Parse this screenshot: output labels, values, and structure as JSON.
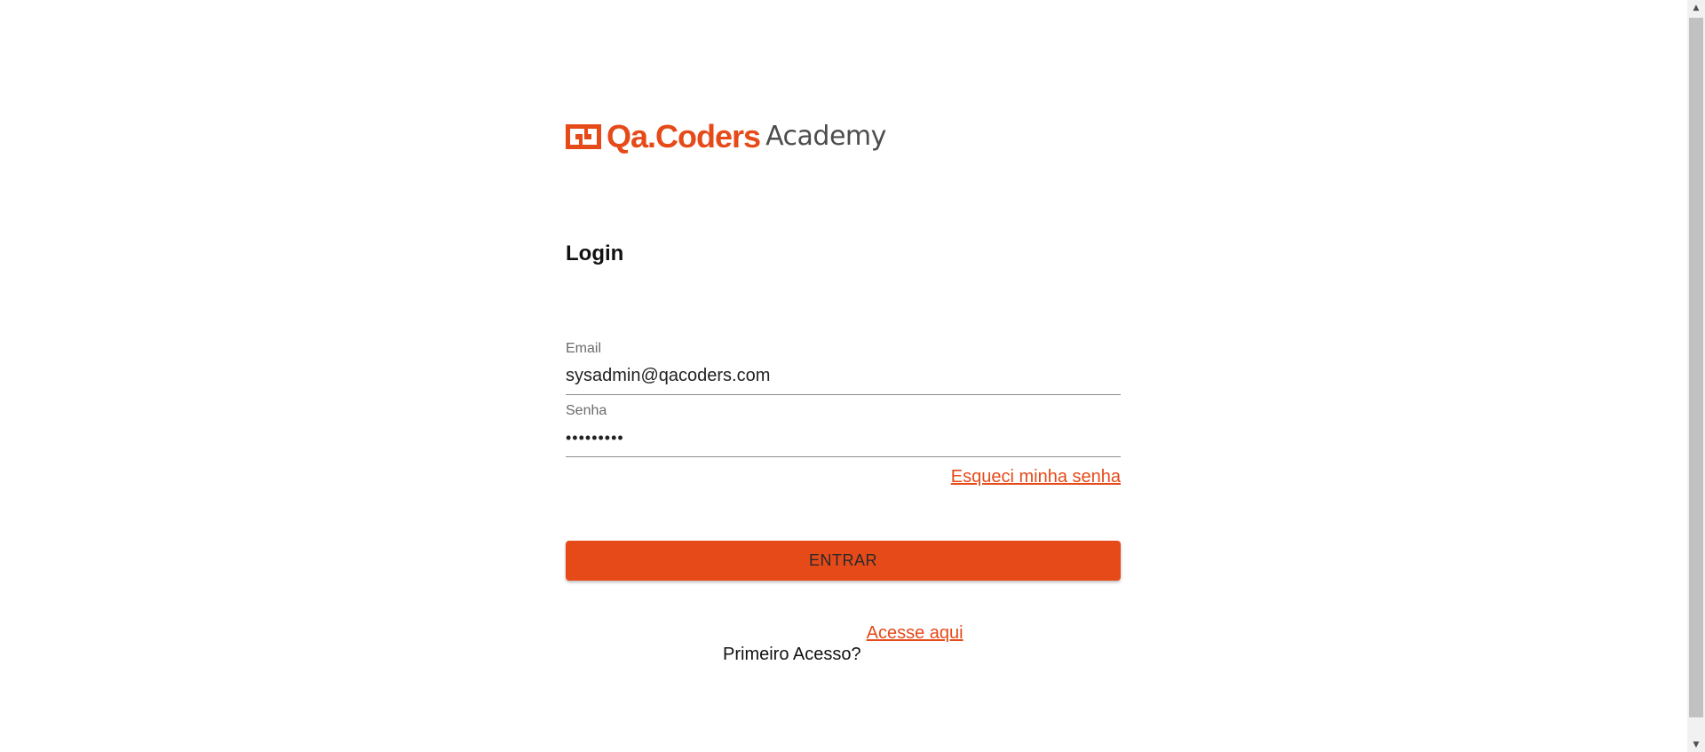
{
  "brand": {
    "name": "Qa.Coders",
    "suffix": "Academy",
    "color": "#e64a19"
  },
  "login": {
    "title": "Login",
    "email": {
      "label": "Email",
      "value": "sysadmin@qacoders.com"
    },
    "password": {
      "label": "Senha",
      "value": "•••••••••"
    },
    "forgot_password": "Esqueci minha senha",
    "submit": "ENTRAR",
    "first_access": {
      "text": "Primeiro Acesso?",
      "link": "Acesse aqui"
    }
  },
  "colors": {
    "accent": "#e64a19",
    "text": "#111111",
    "label": "#6b6b6b",
    "underline": "#8c8c8c"
  },
  "icons": {
    "logo": "qacoders-logo-icon",
    "scroll_up": "scroll-up-icon",
    "scroll_down": "scroll-down-icon"
  }
}
